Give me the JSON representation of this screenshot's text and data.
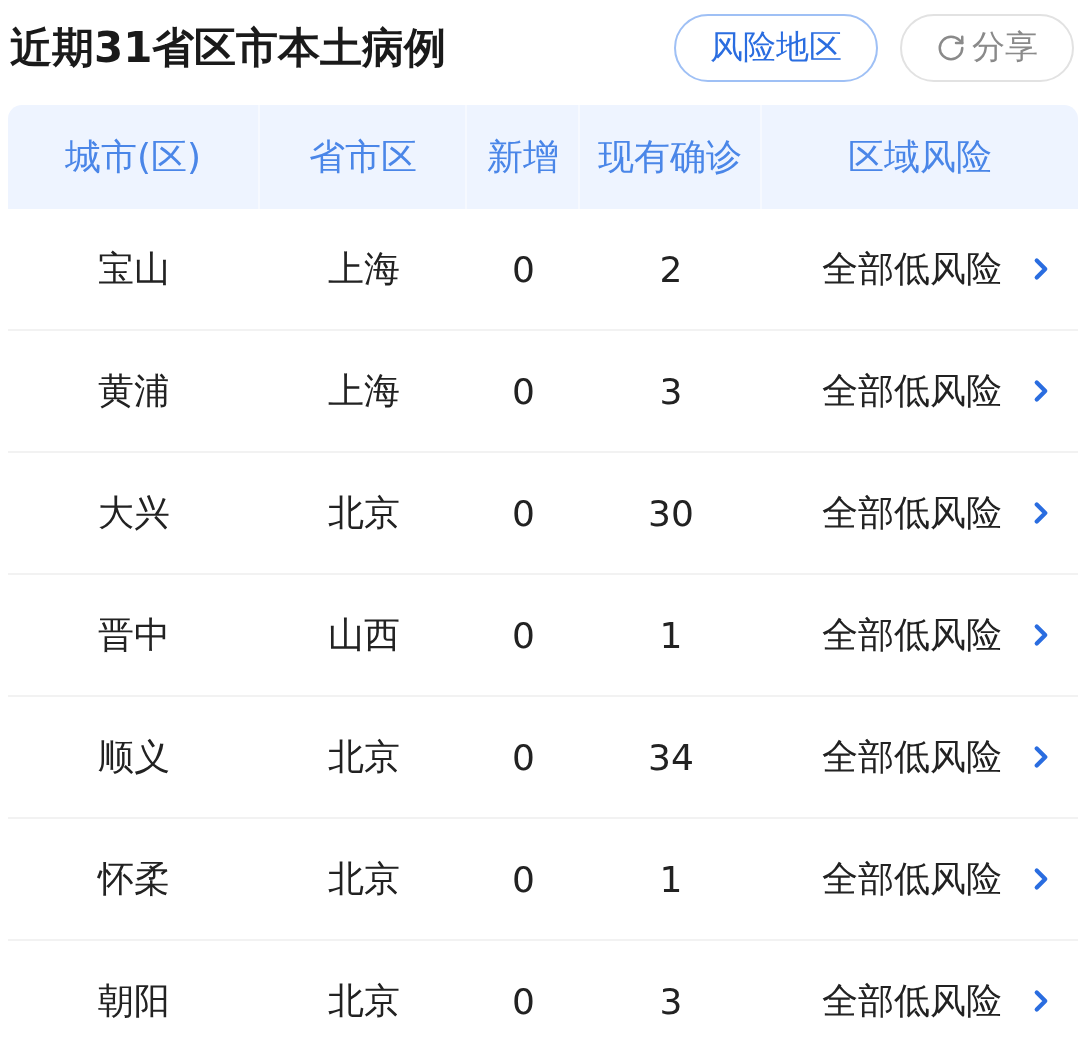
{
  "title": "近期31省区市本土病例",
  "buttons": [
    {
      "label": "风险地区",
      "kind": "primary"
    },
    {
      "label": "分享",
      "kind": "share"
    }
  ],
  "table": {
    "columns": [
      "城市(区)",
      "省市区",
      "新增",
      "现有确诊",
      "区域风险"
    ],
    "rows": [
      {
        "city": "宝山",
        "province": "上海",
        "new": "0",
        "current": "2",
        "risk": "全部低风险"
      },
      {
        "city": "黄浦",
        "province": "上海",
        "new": "0",
        "current": "3",
        "risk": "全部低风险"
      },
      {
        "city": "大兴",
        "province": "北京",
        "new": "0",
        "current": "30",
        "risk": "全部低风险"
      },
      {
        "city": "晋中",
        "province": "山西",
        "new": "0",
        "current": "1",
        "risk": "全部低风险"
      },
      {
        "city": "顺义",
        "province": "北京",
        "new": "0",
        "current": "34",
        "risk": "全部低风险"
      },
      {
        "city": "怀柔",
        "province": "北京",
        "new": "0",
        "current": "1",
        "risk": "全部低风险"
      },
      {
        "city": "朝阳",
        "province": "北京",
        "new": "0",
        "current": "3",
        "risk": "全部低风险"
      }
    ]
  }
}
